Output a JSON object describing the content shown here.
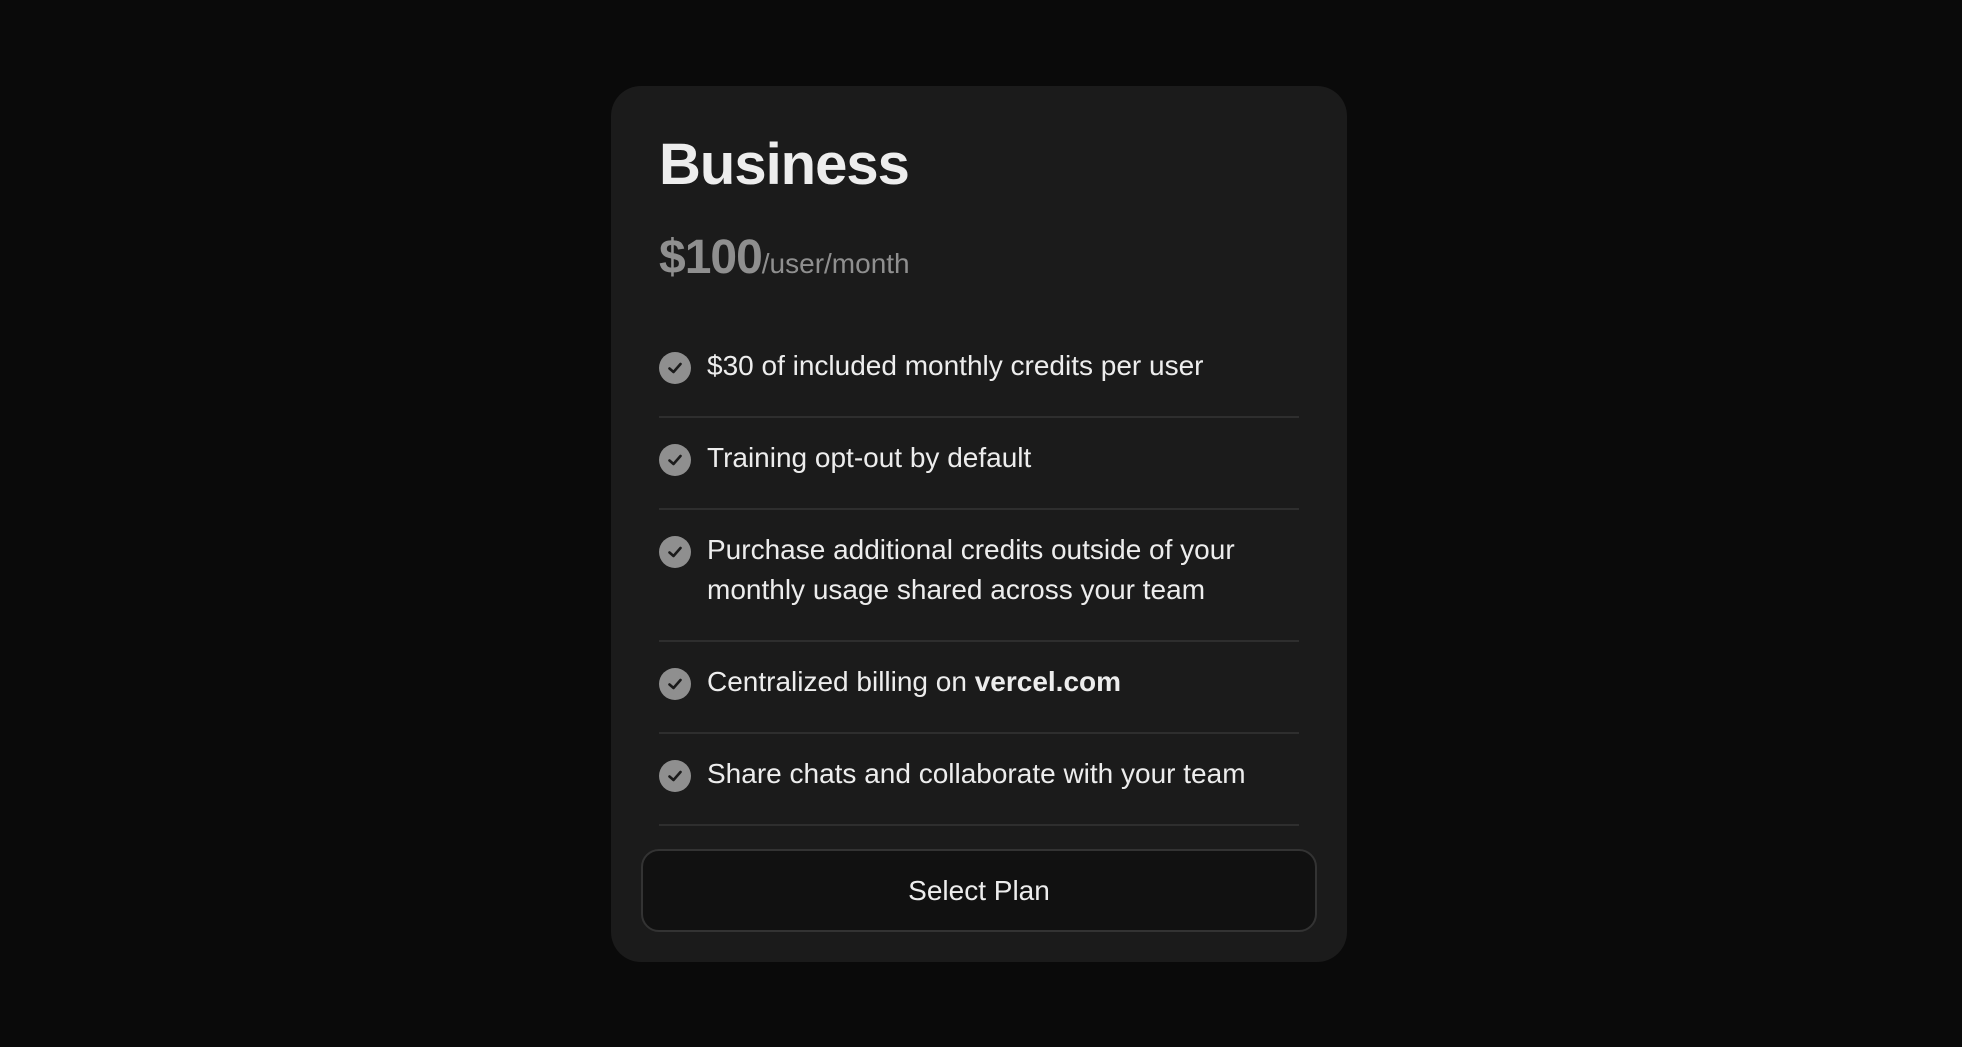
{
  "plan": {
    "name": "Business",
    "price_amount": "$100",
    "price_unit": "/user/month"
  },
  "features": [
    {
      "text": "$30 of included monthly credits per user",
      "icon": "check-circle-icon"
    },
    {
      "text": "Training opt-out by default",
      "icon": "check-circle-icon"
    },
    {
      "text": "Purchase additional credits outside of your monthly usage shared across your team",
      "icon": "check-circle-icon"
    },
    {
      "text_prefix": "Centralized billing on ",
      "text_emphasis": "vercel.com",
      "icon": "check-circle-icon"
    },
    {
      "text": "Share chats and collaborate with your team",
      "icon": "check-circle-icon"
    }
  ],
  "cta": {
    "label": "Select Plan"
  },
  "colors": {
    "background": "#0a0a0a",
    "card": "#1b1b1b",
    "text_primary": "#ededed",
    "text_muted": "#8f8f8f",
    "divider": "#2e2e2e",
    "button_bg": "#111111",
    "button_border": "#333333"
  }
}
